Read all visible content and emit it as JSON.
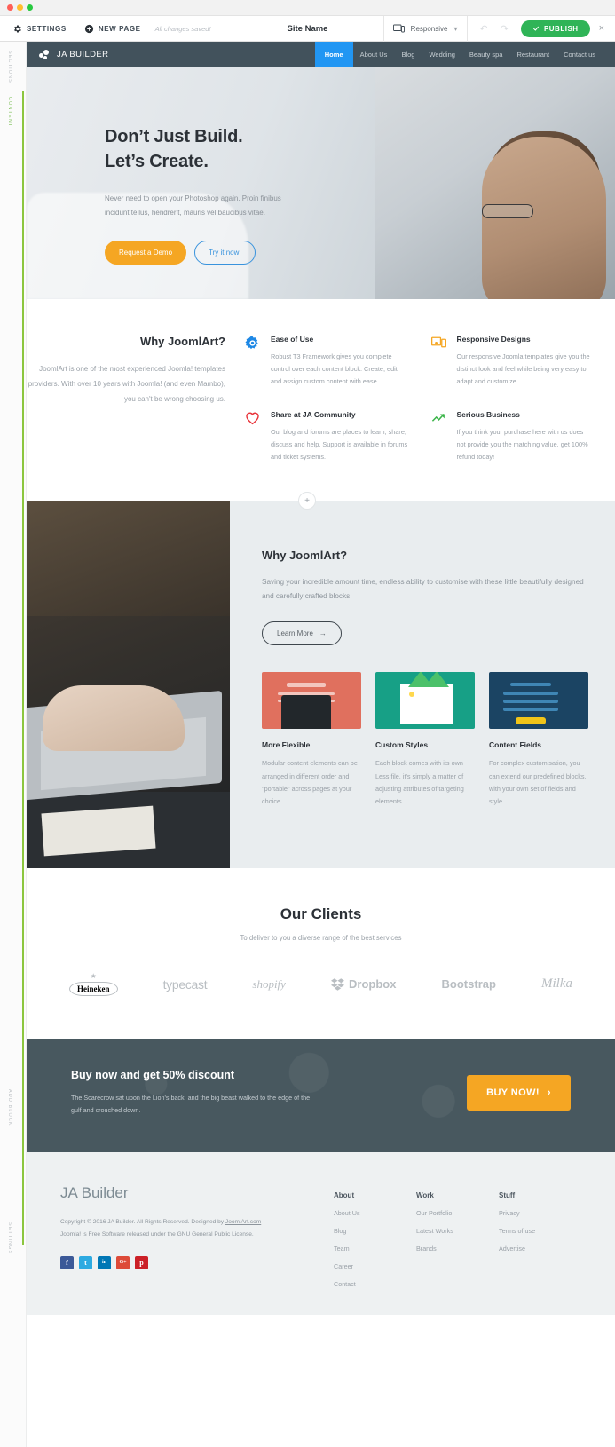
{
  "editor": {
    "settings_label": "SETTINGS",
    "new_page_label": "NEW PAGE",
    "saved_status": "All changes saved!",
    "site_title": "Site Name",
    "viewport_label": "Responsive",
    "publish_label": "PUBLISH",
    "close_label": "×",
    "rail_tabs": [
      "SECTIONS",
      "CONTENT",
      "ADD BLOCK",
      "SETTINGS"
    ]
  },
  "site": {
    "brand": "JA BUILDER",
    "nav": [
      {
        "label": "Home",
        "active": true
      },
      {
        "label": "About Us",
        "active": false
      },
      {
        "label": "Blog",
        "active": false
      },
      {
        "label": "Wedding",
        "active": false
      },
      {
        "label": "Beauty spa",
        "active": false
      },
      {
        "label": "Restaurant",
        "active": false
      },
      {
        "label": "Contact us",
        "active": false
      }
    ]
  },
  "hero": {
    "heading_line1": "Don’t Just Build.",
    "heading_line2": "Let’s Create.",
    "paragraph": "Never need to open your Photoshop again. Proin finibus incidunt tellus, hendrerit, mauris vel baucibus vitae.",
    "primary_button": "Request a Demo",
    "secondary_button": "Try it now!"
  },
  "features": {
    "heading": "Why JoomlArt?",
    "paragraph": "JoomlArt is one of the most experienced Joomla! templates providers. With over 10 years with Joomla! (and even Mambo), you can't be wrong choosing us.",
    "items": [
      {
        "icon": "gear-icon",
        "color": "#1e88e5",
        "title": "Ease of Use",
        "text": "Robust T3 Framework gives you complete control over each content block. Create, edit and assign custom content with ease."
      },
      {
        "icon": "monitor-icon",
        "color": "#f5a623",
        "title": "Responsive Designs",
        "text": "Our responsive Joomla templates give you the distinct look and feel while being very easy to adapt and customize."
      },
      {
        "icon": "heart-icon",
        "color": "#e8333a",
        "title": "Share at JA Community",
        "text": "Our blog and forums are places to learn, share, discuss and help. Support is available in forums and ticket systems."
      },
      {
        "icon": "trending-up-icon",
        "color": "#3cb54a",
        "title": "Serious Business",
        "text": "If you think your purchase here with us does not provide you the matching value, get 100% refund today!"
      }
    ]
  },
  "split": {
    "add_block_label": "+",
    "heading": "Why JoomlArt?",
    "paragraph": "Saving your incredible amount time, endless ability to customise with these little beautifully designed and carefully crafted blocks.",
    "learn_more": "Learn More",
    "learn_more_arrow": "→",
    "cards": [
      {
        "title": "More Flexible",
        "text": "Modular content elements can be arranged in different order and \"portable\" across pages at your choice.",
        "color": "#e0705e"
      },
      {
        "title": "Custom Styles",
        "text": "Each block comes with its own Less file, it's simply a matter of adjusting attributes of targeting elements.",
        "color": "#17a086"
      },
      {
        "title": "Content Fields",
        "text": "For complex customisation, you can extend our predefined blocks, with your own set of fields and style.",
        "color": "#1b4463"
      }
    ]
  },
  "clients": {
    "heading": "Our Clients",
    "subheading": "To deliver to you a diverse range of the best services",
    "logos": [
      "Heineken",
      "typecast",
      "shopify",
      "Dropbox",
      "Bootstrap",
      "Milka"
    ]
  },
  "cta": {
    "heading": "Buy now and get 50% discount",
    "paragraph": "The Scarecrow sat upon the Lion's back, and the big beast walked to the edge of the gulf and crouched down.",
    "button": "BUY NOW!",
    "button_arrow": "›",
    "accent_color": "#f5a623"
  },
  "footer": {
    "brand": "JA Builder",
    "copyright_line1_pre": "Copyright © 2016 JA Builder. All Rights Reserved. Designed by ",
    "copyright_line1_link": "JoomlArt.com",
    "copyright_line2_link1": "Joomla!",
    "copyright_line2_mid": " is Free Software released under the ",
    "copyright_line2_link2": "GNU General Public License.",
    "social": [
      {
        "name": "facebook",
        "glyph": "f",
        "color": "#3b5998"
      },
      {
        "name": "twitter",
        "glyph": "t",
        "color": "#2daae1"
      },
      {
        "name": "linkedin",
        "glyph": "in",
        "color": "#0077b5"
      },
      {
        "name": "google-plus",
        "glyph": "G+",
        "color": "#dd4b39"
      },
      {
        "name": "pinterest",
        "glyph": "p",
        "color": "#cb2027"
      }
    ],
    "columns": [
      {
        "title": "About",
        "links": [
          "About Us",
          "Blog",
          "Team",
          "Career",
          "Contact"
        ]
      },
      {
        "title": "Work",
        "links": [
          "Our Portfolio",
          "Latest Works",
          "Brands"
        ]
      },
      {
        "title": "Stuff",
        "links": [
          "Privacy",
          "Terms of use",
          "Advertise"
        ]
      }
    ]
  }
}
